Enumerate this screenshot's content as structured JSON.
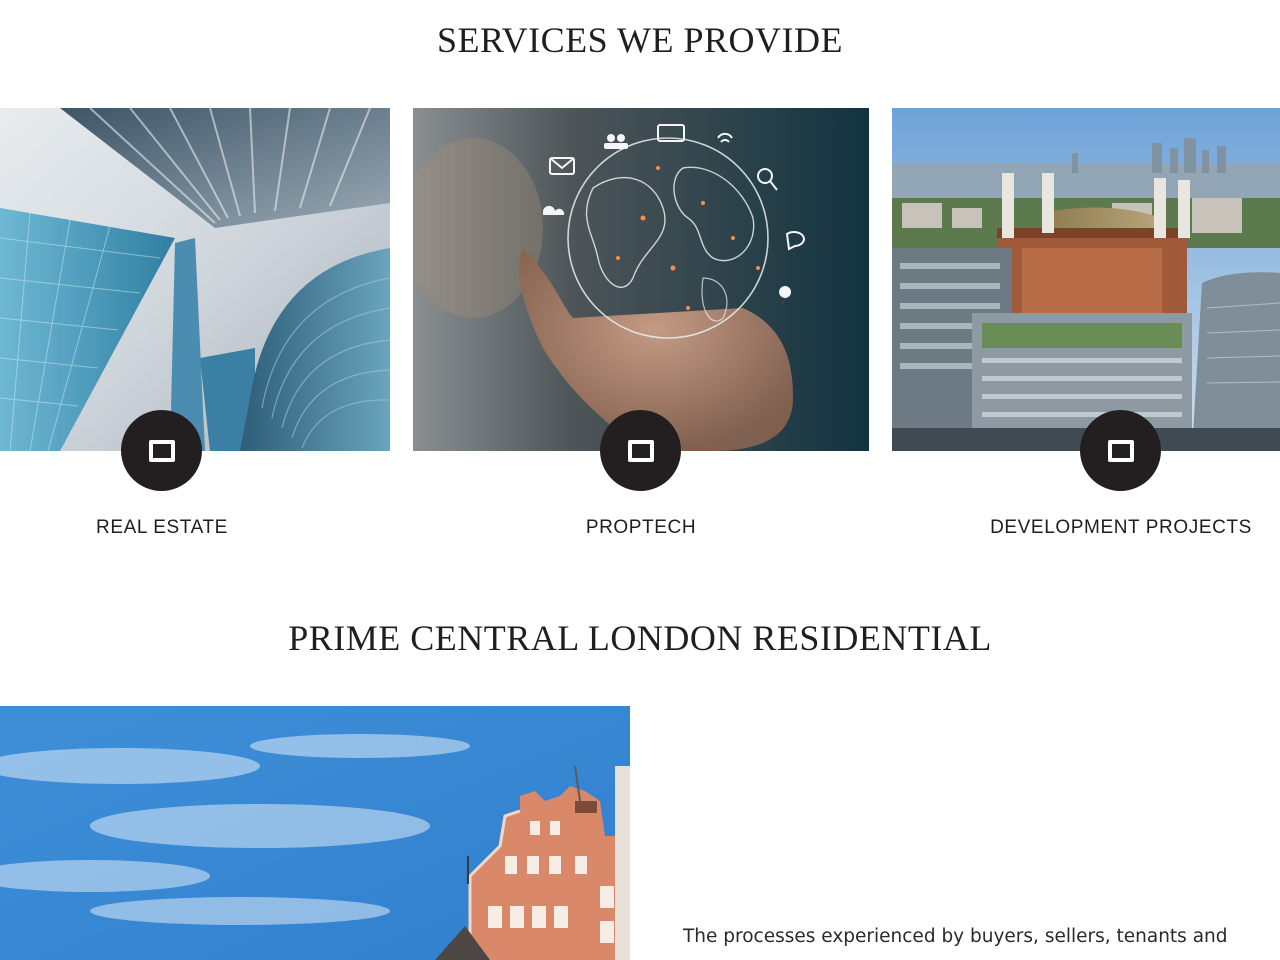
{
  "services": {
    "title": "SERVICES WE PROVIDE",
    "items": [
      {
        "label": "REAL ESTATE",
        "icon": "square-icon",
        "image": "glass-skyscrapers-photo"
      },
      {
        "label": "PROPTECH",
        "icon": "square-icon",
        "image": "digital-globe-hand-photo"
      },
      {
        "label": "DEVELOPMENT PROJECTS",
        "icon": "square-icon",
        "image": "battersea-power-station-photo"
      }
    ]
  },
  "residential": {
    "title": "PRIME CENTRAL LONDON RESIDENTIAL",
    "image": "red-brick-building-sky-photo",
    "body": "The processes experienced by buyers, sellers, tenants and"
  },
  "colors": {
    "icon_circle": "#231f20",
    "text": "#1f1f1f",
    "background": "#ffffff"
  }
}
